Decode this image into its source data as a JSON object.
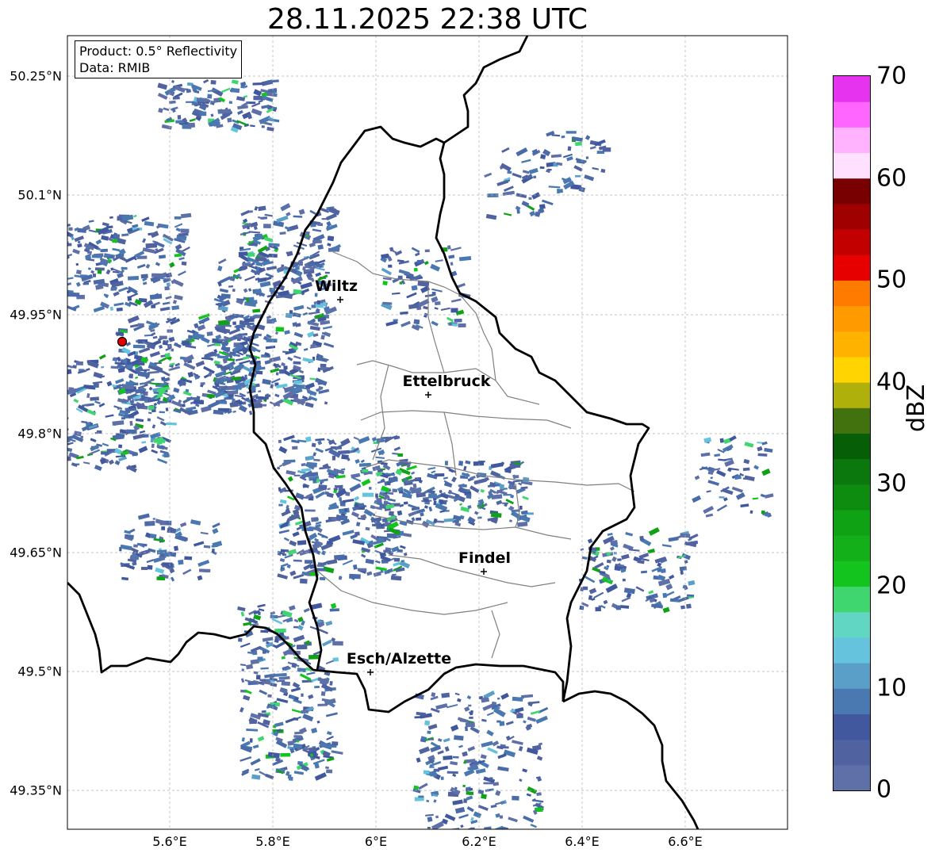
{
  "title": "28.11.2025 22:38 UTC",
  "info": {
    "product": "Product: 0.5° Reflectivity",
    "data": "Data: RMIB"
  },
  "axes": {
    "lat_labels": [
      "50.25°N",
      "50.1°N",
      "49.95°N",
      "49.8°N",
      "49.65°N",
      "49.5°N",
      "49.35°N"
    ],
    "lon_labels": [
      "5.6°E",
      "5.8°E",
      "6°E",
      "6.2°E",
      "6.4°E",
      "6.6°E"
    ]
  },
  "places": [
    {
      "name": "Wiltz"
    },
    {
      "name": "Ettelbruck"
    },
    {
      "name": "Findel"
    },
    {
      "name": "Esch/Alzette"
    }
  ],
  "colorbar": {
    "label": "dBZ",
    "ticks": [
      "70",
      "60",
      "50",
      "40",
      "30",
      "20",
      "10",
      "0"
    ],
    "colors": [
      "#5f70a8",
      "#50629f",
      "#41589f",
      "#4a78b0",
      "#5a9fc8",
      "#65c3dd",
      "#61d6c3",
      "#3fd66f",
      "#13c41e",
      "#13b019",
      "#10a215",
      "#0d8c0f",
      "#0a780c",
      "#065f07",
      "#42720e",
      "#b0b00a",
      "#ffd400",
      "#ffb200",
      "#ff9b00",
      "#ff7b00",
      "#e70000",
      "#c20000",
      "#a10000",
      "#780000",
      "#ffe0ff",
      "#ffb3ff",
      "#ff66ff",
      "#e533f0"
    ]
  },
  "radar_site_color": "#e00000"
}
